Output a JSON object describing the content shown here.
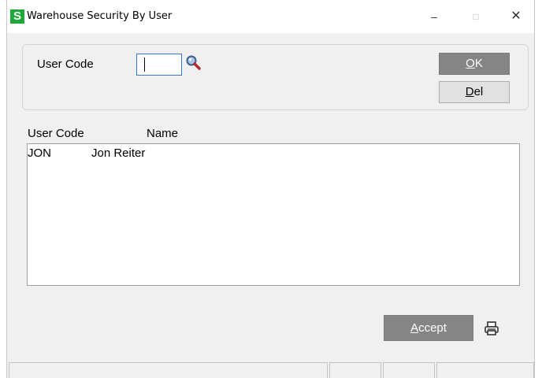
{
  "window": {
    "title": "Warehouse Security By User",
    "icon": "S",
    "icon_color": "#1fa83a",
    "controls": {
      "minimize": "–",
      "maximize": "□",
      "close": "✕"
    }
  },
  "form": {
    "user_code_label": "User Code",
    "user_code_value": "",
    "lookup_icon": "magnifier-icon"
  },
  "buttons": {
    "ok_label": "OK",
    "ok_accel": "O",
    "ok_rest": "K",
    "del_label": "Del",
    "del_accel": "D",
    "del_rest": "el",
    "accept_label": "Accept",
    "accept_accel": "A",
    "accept_rest": "ccept",
    "print_icon": "printer-icon"
  },
  "list": {
    "columns": [
      "User Code",
      "Name"
    ],
    "rows": [
      {
        "code": "JON",
        "name": "Jon Reiter"
      }
    ]
  },
  "colors": {
    "button_dark": "#858585",
    "button_light": "#e1e1e1",
    "focus_border": "#3a78d6"
  }
}
